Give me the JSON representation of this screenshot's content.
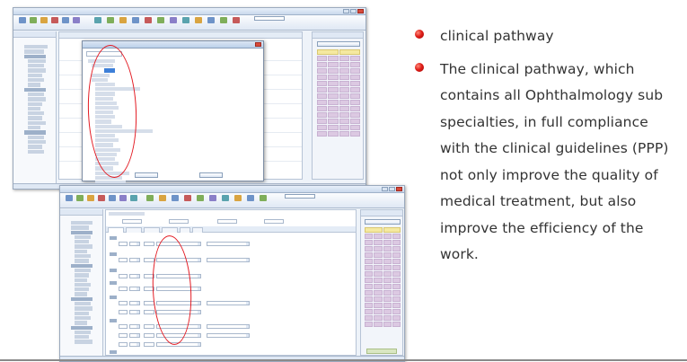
{
  "bullets": [
    "clinical pathway",
    "The clinical pathway, which contains all Ophthalmology sub specialties, in full compliance with the clinical guidelines (PPP) not only improve the quality of medical treatment, but also improve the efficiency of the work."
  ],
  "colors": {
    "bullet": "#e0201a",
    "annotation_ring": "#e31b23",
    "text": "#333333"
  }
}
